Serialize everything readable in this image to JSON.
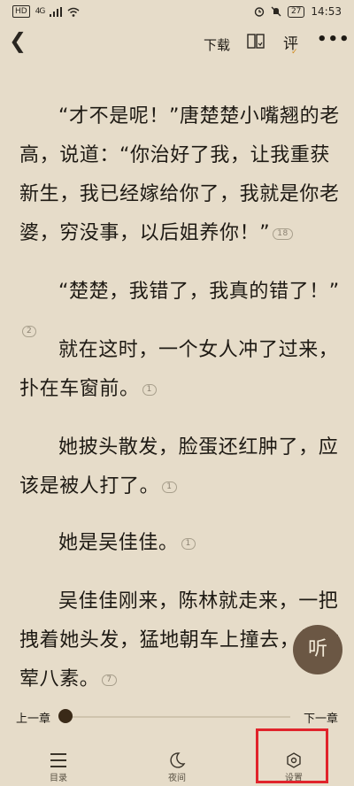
{
  "status_bar": {
    "hd": "HD",
    "network": "4G",
    "battery": "27",
    "time": "14:53"
  },
  "top_bar": {
    "download_label": "下载",
    "comment_label": "评"
  },
  "paragraphs": [
    {
      "text": "“才不是呢！”唐楚楚小嘴翘的老高，说道：“你治好了我，让我重获新生，我已经嫁给你了，我就是你老婆，穷没事，以后姐养你！”",
      "comments": "18"
    },
    {
      "text": "“楚楚，我错了，我真的错了！”",
      "comments": "2"
    },
    {
      "text": "就在这时，一个女人冲了过来，扑在车窗前。",
      "comments": "1"
    },
    {
      "text": "她披头散发，脸蛋还红肿了，应该是被人打了。",
      "comments": "1"
    },
    {
      "text": "她是吴佳佳。",
      "comments": "1"
    },
    {
      "text": "吴佳佳刚来，陈林就走来，一把拽着她头发，猛地朝车上撞去，她七荤八素。",
      "comments": "7"
    }
  ],
  "listen_button": {
    "label": "听"
  },
  "chapter_nav": {
    "prev_label": "上一章",
    "next_label": "下一章",
    "progress": 0
  },
  "bottom_nav": {
    "items": [
      {
        "label": "目录",
        "icon": "menu-icon"
      },
      {
        "label": "夜间",
        "icon": "moon-icon"
      },
      {
        "label": "设置",
        "icon": "settings-icon",
        "highlighted": true
      }
    ]
  }
}
